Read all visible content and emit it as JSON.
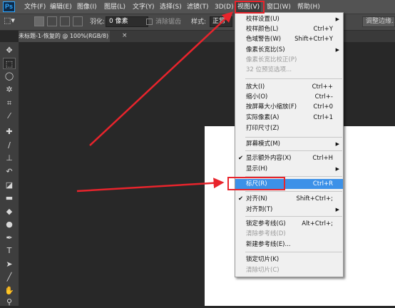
{
  "app": {
    "logo": "Ps"
  },
  "menubar": {
    "items": [
      "文件(F)",
      "编辑(E)",
      "图像(I)",
      "图层(L)",
      "文字(Y)",
      "选择(S)",
      "滤镜(T)",
      "3D(D)",
      "视图(V)",
      "窗口(W)",
      "帮助(H)"
    ],
    "active": "视图(V)"
  },
  "options_bar": {
    "feather_label": "羽化:",
    "feather_value": "0 像素",
    "antialias_label": "消除锯齿",
    "style_label": "样式:",
    "style_value": "正常",
    "refine_button": "调整边缘..."
  },
  "document_tab": {
    "title": "未标题-1-恢复的 @ 100%(RGB/8) *",
    "close": "×"
  },
  "tools": [
    "move-tool",
    "marquee-tool",
    "lasso-tool",
    "magic-wand-tool",
    "crop-tool",
    "eyedropper-tool",
    "healing-brush-tool",
    "brush-tool",
    "clone-stamp-tool",
    "history-brush-tool",
    "eraser-tool",
    "gradient-tool",
    "blur-tool",
    "dodge-tool",
    "pen-tool",
    "type-tool",
    "path-selection-tool",
    "line-tool",
    "hand-tool",
    "zoom-tool"
  ],
  "view_menu": {
    "items": [
      {
        "label": "校样设置(U)",
        "shortcut": "",
        "submenu": true
      },
      {
        "label": "校样颜色(L)",
        "shortcut": "Ctrl+Y"
      },
      {
        "label": "色域警告(W)",
        "shortcut": "Shift+Ctrl+Y"
      },
      {
        "label": "像素长宽比(S)",
        "shortcut": "",
        "submenu": true
      },
      {
        "label": "像素长宽比校正(P)",
        "shortcut": "",
        "disabled": true
      },
      {
        "label": "32 位预览选项...",
        "shortcut": "",
        "disabled": true
      },
      {
        "label": "放大(I)",
        "shortcut": "Ctrl++"
      },
      {
        "label": "缩小(O)",
        "shortcut": "Ctrl+-"
      },
      {
        "label": "按屏幕大小缩放(F)",
        "shortcut": "Ctrl+0"
      },
      {
        "label": "实际像素(A)",
        "shortcut": "Ctrl+1"
      },
      {
        "label": "打印尺寸(Z)",
        "shortcut": ""
      },
      {
        "label": "屏幕模式(M)",
        "shortcut": "",
        "submenu": true
      },
      {
        "label": "显示额外内容(X)",
        "shortcut": "Ctrl+H",
        "checked": true
      },
      {
        "label": "显示(H)",
        "shortcut": "",
        "submenu": true
      },
      {
        "label": "标尺(R)",
        "shortcut": "Ctrl+R",
        "highlighted": true
      },
      {
        "label": "对齐(N)",
        "shortcut": "Shift+Ctrl+;",
        "checked": true
      },
      {
        "label": "对齐到(T)",
        "shortcut": "",
        "submenu": true
      },
      {
        "label": "锁定参考线(G)",
        "shortcut": "Alt+Ctrl+;"
      },
      {
        "label": "清除参考线(D)",
        "shortcut": "",
        "disabled": true
      },
      {
        "label": "新建参考线(E)...",
        "shortcut": ""
      },
      {
        "label": "锁定切片(K)",
        "shortcut": ""
      },
      {
        "label": "清除切片(C)",
        "shortcut": "",
        "disabled": true
      }
    ]
  },
  "annotation_color": "#e8242c"
}
